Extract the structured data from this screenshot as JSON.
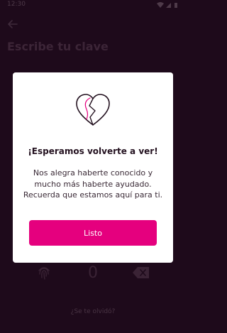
{
  "status_bar": {
    "time": "12:30"
  },
  "screen": {
    "title": "Escribe tu clave",
    "keypad_zero": "0",
    "forgot_link": "¿Se te olvidó?"
  },
  "modal": {
    "title": "¡Esperamos volverte a ver!",
    "message": "Nos alegra haberte conocido y mucho más haberte ayudado. Recuerda que estamos aquí para ti.",
    "button_label": "Listo",
    "icon": "broken-heart-icon"
  },
  "colors": {
    "background_overlay": "#1e0a1b",
    "accent": "#e5007e",
    "modal_background": "#ffffff",
    "title_text": "#241220"
  }
}
